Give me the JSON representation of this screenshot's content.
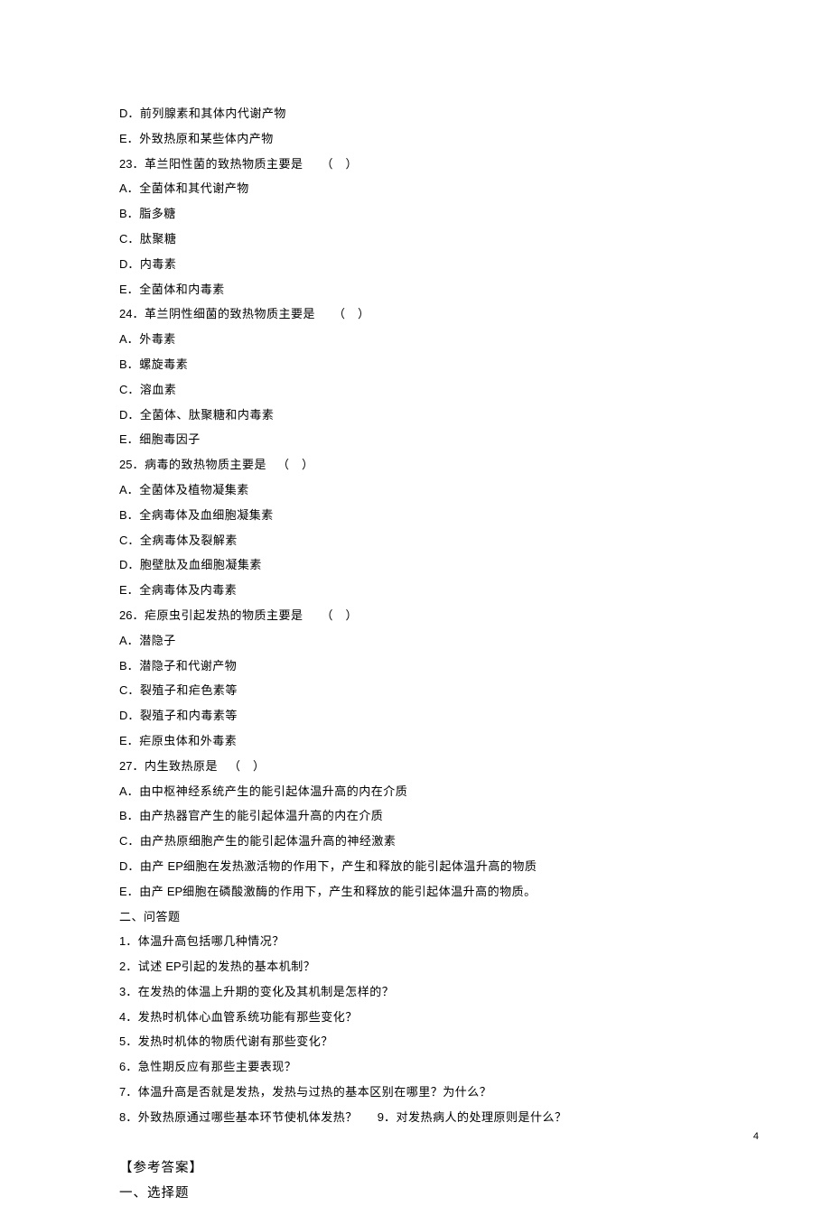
{
  "q22": {
    "D": "前列腺素和其体内代谢产物",
    "E": "外致热原和某些体内产物"
  },
  "q23": {
    "stem": "．革兰阳性菌的致热物质主要是",
    "paren": "（　）",
    "A": "全菌体和其代谢产物",
    "B": "脂多糖",
    "C": "肽聚糖",
    "D": "内毒素",
    "E": "全菌体和内毒素"
  },
  "q24": {
    "stem": "．革兰阴性细菌的致热物质主要是",
    "paren": "（　）",
    "A": "外毒素",
    "B": "螺旋毒素",
    "C": "溶血素",
    "D": "全菌体、肽聚糖和内毒素",
    "E": "细胞毒因子"
  },
  "q25": {
    "stem": "．病毒的致热物质主要是",
    "paren": "（　）",
    "A": "全菌体及植物凝集素",
    "B": "全病毒体及血细胞凝集素",
    "C": "全病毒体及裂解素",
    "D": "胞壁肽及血细胞凝集素",
    "E": "全病毒体及内毒素"
  },
  "q26": {
    "stem": "．疟原虫引起发热的物质主要是",
    "paren": "（　）",
    "A": "潜隐子",
    "B": "潜隐子和代谢产物",
    "C": "裂殖子和疟色素等",
    "D": "裂殖子和内毒素等",
    "E": "疟原虫体和外毒素"
  },
  "q27": {
    "stem": "．内生致热原是",
    "paren": "（　）",
    "A": "由中枢神经系统产生的能引起体温升高的内在介质",
    "B": "由产热器官产生的能引起体温升高的内在介质",
    "C": "由产热原细胞产生的能引起体温升高的神经激素",
    "D_prefix": "由产",
    "D_ep": " EP",
    "D_suffix": "细胞在发热激活物的作用下，产生和释放的能引起体温升高的物质",
    "E_prefix": "由产",
    "E_ep": " EP",
    "E_suffix": "细胞在磷酸激酶的作用下，产生和释放的能引起体温升高的物质。"
  },
  "section2_title": "二、问答题",
  "qa": {
    "1": "．体温升高包括哪几种情况？",
    "2_prefix": "．试述",
    "2_ep": " EP",
    "2_suffix": "引起的发热的基本机制？",
    "3": "．在发热的体温上升期的变化及其机制是怎样的？",
    "4": "．发热时机体心血管系统功能有那些变化？",
    "5": "．发热时机体的物质代谢有那些变化？",
    "6": "．急性期反应有那些主要表现？",
    "7": "．体温升高是否就是发热，发热与过热的基本区别在哪里？为什么？",
    "8": "．外致热原通过哪些基本环节使机体发热？",
    "9": "．对发热病人的处理原则是什么？"
  },
  "answers_heading": "【参考答案】",
  "answers_sub": "一、选择题",
  "page_number": "4"
}
